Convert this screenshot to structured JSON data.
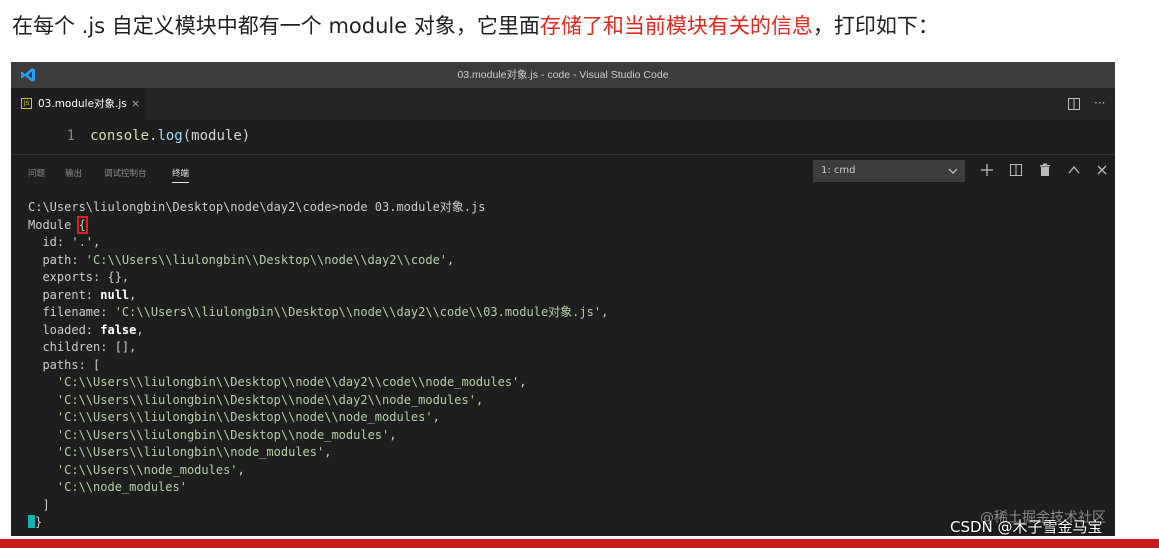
{
  "caption": {
    "before": "在每个 .js 自定义模块中都有一个 module 对象，它里面",
    "highlight": "存储了和当前模块有关的信息",
    "after": "，打印如下："
  },
  "window": {
    "title": "03.module对象.js - code - Visual Studio Code"
  },
  "tabs": [
    {
      "label": "03.module对象.js",
      "close": "×"
    }
  ],
  "tabbar": {
    "more": "···"
  },
  "editor": {
    "line_number": "1",
    "code": {
      "object": "console",
      "dot": ".",
      "method": "log",
      "args": "(module)"
    }
  },
  "panel": {
    "tabs": [
      "问题",
      "输出",
      "调试控制台",
      "终端"
    ],
    "active_tab": "终端",
    "terminal_selector": "1: cmd"
  },
  "terminal": {
    "prompt": "C:\\Users\\liulongbin\\Desktop\\node\\day2\\code>node 03.module对象.js",
    "module_open": "Module ",
    "brace_open": "{",
    "id_key": "  id: ",
    "id_val": "'.'",
    "path_key": "  path: ",
    "path_val": "'C:\\\\Users\\\\liulongbin\\\\Desktop\\\\node\\\\day2\\\\code'",
    "exports_line": "  exports: {},",
    "parent_key": "  parent: ",
    "parent_val": "null",
    "filename_key": "  filename: ",
    "filename_val": "'C:\\\\Users\\\\liulongbin\\\\Desktop\\\\node\\\\day2\\\\code\\\\03.module对象.js'",
    "loaded_key": "  loaded: ",
    "loaded_val": "false",
    "children_line": "  children: [],",
    "paths_line": "  paths: [",
    "paths": [
      "'C:\\\\Users\\\\liulongbin\\\\Desktop\\\\node\\\\day2\\\\code\\\\node_modules'",
      "'C:\\\\Users\\\\liulongbin\\\\Desktop\\\\node\\\\day2\\\\node_modules'",
      "'C:\\\\Users\\\\liulongbin\\\\Desktop\\\\node\\\\node_modules'",
      "'C:\\\\Users\\\\liulongbin\\\\Desktop\\\\node_modules'",
      "'C:\\\\Users\\\\liulongbin\\\\node_modules'",
      "'C:\\\\Users\\\\node_modules'",
      "'C:\\\\node_modules'"
    ],
    "paths_close": "  ]",
    "brace_close": "}"
  },
  "footer": {
    "watermark": "@稀土掘金技术社区",
    "credit": "CSDN @木子雪金马宝"
  },
  "colors": {
    "highlight": "#e0281f",
    "string": "#b5cea8",
    "cursor": "#14b3b3",
    "bottom_bar": "#c81a1a"
  }
}
